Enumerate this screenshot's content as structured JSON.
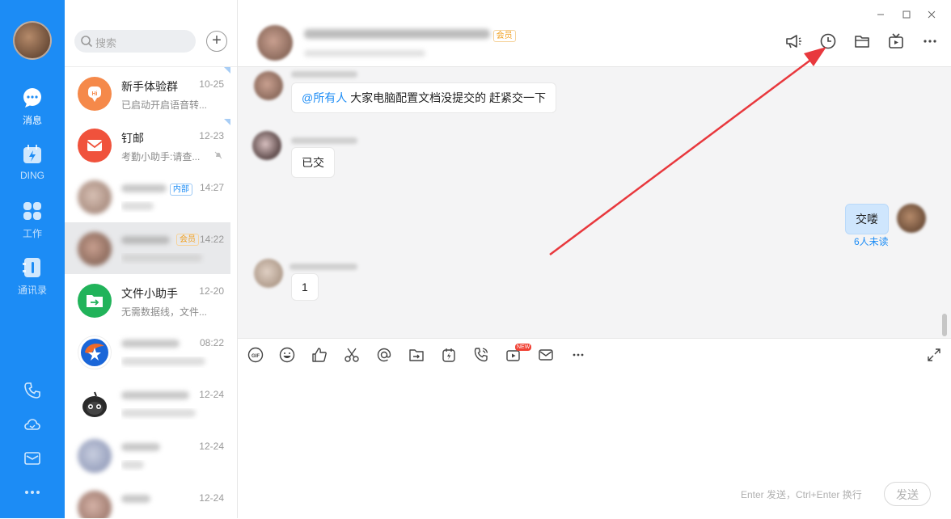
{
  "sidebar": {
    "items": [
      {
        "label": "消息",
        "icon": "chat-bubble-icon",
        "active": true
      },
      {
        "label": "DING",
        "icon": "ding-icon",
        "active": false
      },
      {
        "label": "工作",
        "icon": "apps-grid-icon",
        "active": false
      },
      {
        "label": "通讯录",
        "icon": "contacts-icon",
        "active": false
      }
    ],
    "bottom_icons": [
      "phone-icon",
      "cloud-icon",
      "mail-icon",
      "more-icon"
    ]
  },
  "conversation_list": {
    "search_placeholder": "搜索",
    "conversations": [
      {
        "name": "新手体验群",
        "time": "10-25",
        "preview": "已启动开启语音转...",
        "pinned": true
      },
      {
        "name": "钉邮",
        "time": "12-23",
        "preview": "考勤小助手:请查...",
        "pinned": true
      },
      {
        "name": "",
        "time": "14:27",
        "preview": "",
        "tag": "内部"
      },
      {
        "name": "",
        "time": "14:22",
        "preview": "",
        "tag": "会员",
        "selected": true
      },
      {
        "name": "文件小助手",
        "time": "12-20",
        "preview": "无需数据线，文件..."
      },
      {
        "name": "",
        "time": "08:22",
        "preview": ""
      },
      {
        "name": "",
        "time": "12-24",
        "preview": ""
      },
      {
        "name": "",
        "time": "12-24",
        "preview": ""
      },
      {
        "name": "",
        "time": "12-24",
        "preview": ""
      }
    ]
  },
  "chat": {
    "header": {
      "badge": "会员",
      "icons": [
        "announcement-icon",
        "history-clock-icon",
        "folder-icon",
        "live-tv-icon",
        "more-icon"
      ]
    },
    "messages": [
      {
        "text_mention": "@所有人",
        "text": " 大家电脑配置文档没提交的 赶紧交一下",
        "mine": false
      },
      {
        "text": "已交",
        "mine": false
      },
      {
        "text": "交喽",
        "mine": true,
        "read_status": "6人未读"
      },
      {
        "text": "1",
        "mine": false
      }
    ],
    "toolbar": {
      "new_badge": "NEW",
      "icons": [
        "gif-icon",
        "emoji-icon",
        "thumbs-up-icon",
        "scissors-icon",
        "at-icon",
        "file-send-icon",
        "ding-icon",
        "phone-call-icon",
        "video-icon",
        "mail-icon",
        "more-icon"
      ]
    },
    "hint": "Enter 发送，Ctrl+Enter 换行",
    "send_label": "发送"
  },
  "colors": {
    "sidebar": "#1c8cf5",
    "bubble_mine": "#cfe6fd",
    "mention": "#1c8cf5",
    "arrow": "#e8383d"
  }
}
